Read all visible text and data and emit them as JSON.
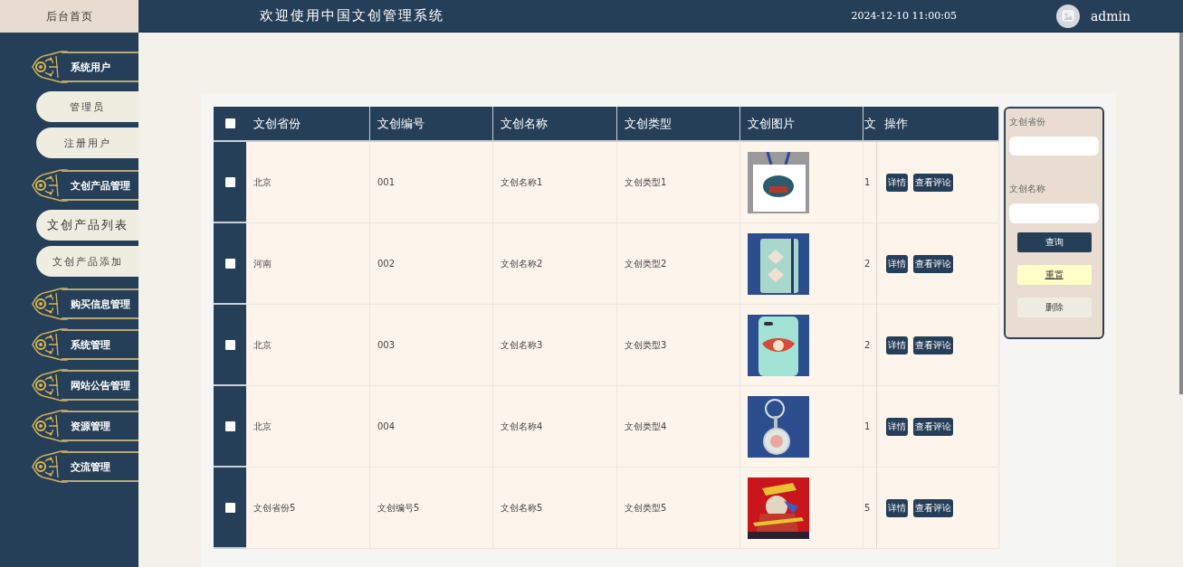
{
  "header": {
    "home_link": "后台首页",
    "title": "欢迎使用中国文创管理系统",
    "datetime": "2024-12-10 11:00:05",
    "user": "admin"
  },
  "sidebar": {
    "items": [
      {
        "label": "系统用户",
        "children": [
          {
            "label": "管理员",
            "selected": false
          },
          {
            "label": "注册用户",
            "selected": false
          }
        ]
      },
      {
        "label": "文创产品管理",
        "children": [
          {
            "label": "文创产品列表",
            "selected": true
          },
          {
            "label": "文创产品添加",
            "selected": false
          }
        ]
      },
      {
        "label": "购买信息管理"
      },
      {
        "label": "系统管理"
      },
      {
        "label": "网站公告管理"
      },
      {
        "label": "资源管理"
      },
      {
        "label": "交流管理"
      }
    ]
  },
  "table": {
    "header_checked": false,
    "columns": [
      "文创省份",
      "文创编号",
      "文创名称",
      "文创类型",
      "文创图片",
      "文",
      "操作"
    ],
    "rows": [
      {
        "checked": false,
        "cells": [
          "北京",
          "001",
          "文创名称1",
          "文创类型1"
        ],
        "image": {
          "kind": "picture"
        },
        "column_7": "1",
        "actions": [
          "详情",
          "查看评论"
        ]
      },
      {
        "checked": false,
        "cells": [
          "河南",
          "002",
          "文创名称2",
          "文创类型2"
        ],
        "image": {
          "kind": "picture"
        },
        "column_7": "2",
        "actions": [
          "详情",
          "查看评论"
        ]
      },
      {
        "checked": false,
        "cells": [
          "北京",
          "003",
          "文创名称3",
          "文创类型3"
        ],
        "image": {
          "kind": "picture"
        },
        "column_7": "2",
        "actions": [
          "详情",
          "查看评论"
        ]
      },
      {
        "checked": false,
        "cells": [
          "北京",
          "004",
          "文创名称4",
          "文创类型4"
        ],
        "image": {
          "kind": "picture"
        },
        "column_7": "1",
        "actions": [
          "详情",
          "查看评论"
        ]
      },
      {
        "checked": false,
        "cells": [
          "文创省份5",
          "文创编号5",
          "文创名称5",
          "文创类型5"
        ],
        "image": {
          "kind": "picture"
        },
        "column_7": "5",
        "actions": [
          "详情",
          "查看评论"
        ]
      }
    ]
  },
  "search": {
    "fields": [
      {
        "label": "文创省份"
      },
      {
        "label": "文创名称"
      }
    ],
    "buttons": [
      {
        "label": "查询",
        "kind": "primary"
      },
      {
        "label": "重置",
        "kind": "reset"
      },
      {
        "label": "删除",
        "kind": "delete"
      }
    ]
  }
}
